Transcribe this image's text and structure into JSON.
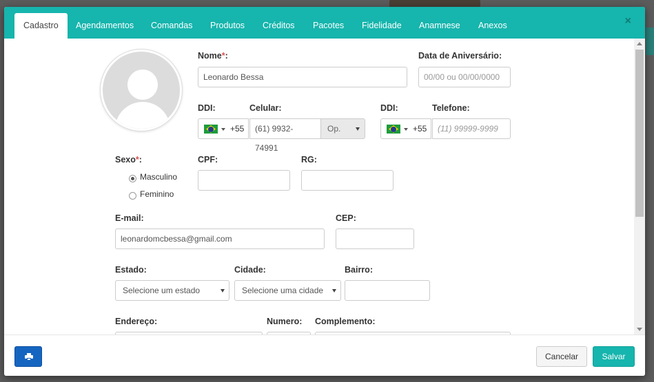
{
  "tabs": [
    "Cadastro",
    "Agendamentos",
    "Comandas",
    "Produtos",
    "Créditos",
    "Pacotes",
    "Fidelidade",
    "Anamnese",
    "Anexos"
  ],
  "close_label": "×",
  "form": {
    "nome": {
      "label": "Nome",
      "required_mark": "*",
      "colon": ":",
      "value": "Leonardo Bessa"
    },
    "aniversario": {
      "label": "Data de Aniversário:",
      "placeholder": "00/00 ou 00/00/0000"
    },
    "ddi1": {
      "label": "DDI:",
      "code": "+55"
    },
    "celular": {
      "label": "Celular:",
      "value": "(61) 9932-74991",
      "operator": "Op."
    },
    "ddi2": {
      "label": "DDI:",
      "code": "+55"
    },
    "telefone": {
      "label": "Telefone:",
      "placeholder": "(11) 99999-9999"
    },
    "sexo": {
      "label": "Sexo",
      "required_mark": "*",
      "colon": ":",
      "options": [
        "Masculino",
        "Feminino"
      ],
      "selected": "Masculino"
    },
    "cpf": {
      "label": "CPF:"
    },
    "rg": {
      "label": "RG:"
    },
    "email": {
      "label": "E-mail:",
      "value": "leonardomcbessa@gmail.com"
    },
    "cep": {
      "label": "CEP:"
    },
    "estado": {
      "label": "Estado:",
      "value": "Selecione um estado"
    },
    "cidade": {
      "label": "Cidade:",
      "value": "Selecione uma cidade"
    },
    "bairro": {
      "label": "Bairro:"
    },
    "endereco": {
      "label": "Endereço:"
    },
    "numero": {
      "label": "Numero:"
    },
    "complemento": {
      "label": "Complemento:"
    }
  },
  "footer": {
    "print_icon": "printer-icon",
    "cancel_label": "Cancelar",
    "save_label": "Salvar"
  },
  "colors": {
    "accent": "#16b5ad",
    "print_button": "#1565c0",
    "required": "#d9534f"
  }
}
